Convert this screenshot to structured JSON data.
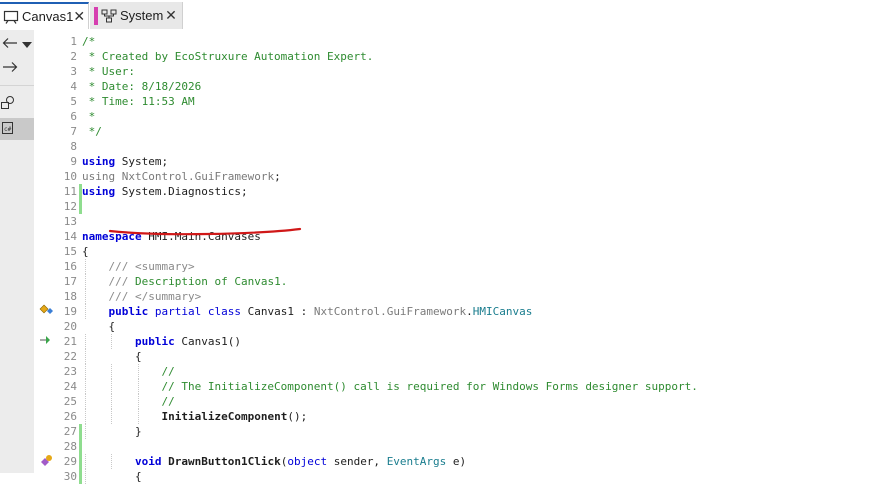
{
  "tabs": [
    {
      "label": "Canvas1",
      "active": true,
      "icon": "canvas-icon"
    },
    {
      "label": "System",
      "active": false,
      "icon": "system-icon"
    }
  ],
  "toolbox": {
    "icons": [
      "back-arrow-icon",
      "dropdown-icon",
      "forward-arrow-icon",
      "shapes-icon",
      "code-file-icon"
    ]
  },
  "colors": {
    "keyword": "#0000d8",
    "comment": "#2e8b30",
    "type": "#1a7d8e",
    "changed_marker": "#8fdd8f",
    "annotation": "#d01818"
  },
  "editor": {
    "lines": [
      {
        "n": "1",
        "text": "/*"
      },
      {
        "n": "2",
        "text": " * Created by EcoStruxure Automation Expert."
      },
      {
        "n": "3",
        "text": " * User:"
      },
      {
        "n": "4",
        "text": " * Date: 8/18/2026"
      },
      {
        "n": "5",
        "text": " * Time: 11:53 AM"
      },
      {
        "n": "6",
        "text": " *"
      },
      {
        "n": "7",
        "text": " */"
      },
      {
        "n": "8",
        "text": ""
      },
      {
        "n": "9",
        "text": "using System;"
      },
      {
        "n": "10",
        "text": "using NxtControl.GuiFramework;"
      },
      {
        "n": "11",
        "text": "using System.Diagnostics;"
      },
      {
        "n": "12",
        "text": ""
      },
      {
        "n": "13",
        "text": ""
      },
      {
        "n": "14",
        "text": "namespace HMI.Main.Canvases"
      },
      {
        "n": "15",
        "text": "{"
      },
      {
        "n": "16",
        "text": "    /// <summary>"
      },
      {
        "n": "17",
        "text": "    /// Description of Canvas1."
      },
      {
        "n": "18",
        "text": "    /// </summary>"
      },
      {
        "n": "19",
        "text": "    public partial class Canvas1 : NxtControl.GuiFramework.HMICanvas"
      },
      {
        "n": "20",
        "text": "    {"
      },
      {
        "n": "21",
        "text": "        public Canvas1()"
      },
      {
        "n": "22",
        "text": "        {"
      },
      {
        "n": "23",
        "text": "            //"
      },
      {
        "n": "24",
        "text": "            // The InitializeComponent() call is required for Windows Forms designer support."
      },
      {
        "n": "25",
        "text": "            //"
      },
      {
        "n": "26",
        "text": "            InitializeComponent();"
      },
      {
        "n": "27",
        "text": "        }"
      },
      {
        "n": "28",
        "text": ""
      },
      {
        "n": "29",
        "text": "        void DrawnButton1Click(object sender, EventArgs e)"
      },
      {
        "n": "30",
        "text": "        {"
      }
    ]
  }
}
